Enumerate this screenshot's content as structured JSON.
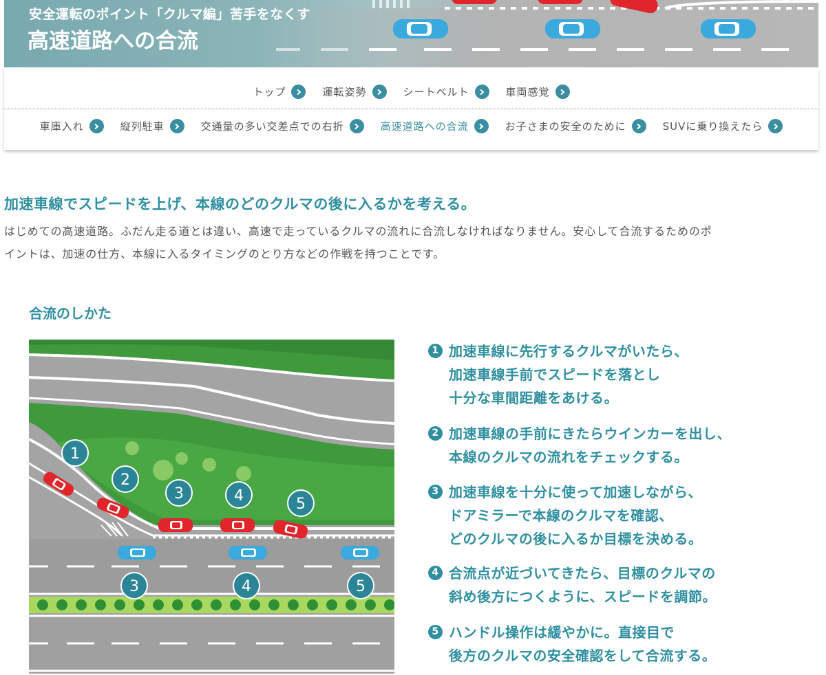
{
  "hero": {
    "subtitle": "安全運転のポイント「クルマ編」苦手をなくす",
    "title": "高速道路への合流"
  },
  "nav": {
    "row1": [
      {
        "label": "トップ"
      },
      {
        "label": "運転姿勢"
      },
      {
        "label": "シートベルト"
      },
      {
        "label": "車両感覚"
      }
    ],
    "row2": [
      {
        "label": "車庫入れ"
      },
      {
        "label": "縦列駐車"
      },
      {
        "label": "交通量の多い交差点での右折"
      },
      {
        "label": "高速道路への合流",
        "active": true
      },
      {
        "label": "お子さまの安全のために"
      },
      {
        "label": "SUVに乗り換えたら"
      }
    ]
  },
  "content": {
    "heading": "加速車線でスピードを上げ、本線のどのクルマの後に入るかを考える。",
    "intro_line1": "はじめての高速道路。ふだん走る道とは違い、高速で走っているクルマの流れに合流しなければなりません。安心して合流するためのポ",
    "intro_line2": "イントは、加速の仕方、本線に入るタイミングのとり方などの作戦を持つことです。",
    "section_title": "合流のしかた"
  },
  "diagram_labels": {
    "merge": [
      "1",
      "2",
      "3",
      "4",
      "5"
    ],
    "main": [
      "3",
      "4",
      "5"
    ]
  },
  "steps": [
    {
      "num": "1",
      "lines": [
        "加速車線に先行するクルマがいたら、",
        "加速車線手前でスピードを落とし",
        "十分な車間距離をあける。"
      ]
    },
    {
      "num": "2",
      "lines": [
        "加速車線の手前にきたらウインカーを出し、",
        "本線のクルマの流れをチェックする。"
      ]
    },
    {
      "num": "3",
      "lines": [
        "加速車線を十分に使って加速しながら、",
        "ドアミラーで本線のクルマを確認、",
        "どのクルマの後に入るか目標を決める。"
      ]
    },
    {
      "num": "4",
      "lines": [
        "合流点が近づいてきたら、目標のクルマの",
        "斜め後方につくように、スピードを調節。"
      ]
    },
    {
      "num": "5",
      "lines": [
        "ハンドル操作は緩やかに。直接目で",
        "後方のクルマの安全確認をして合流する。"
      ]
    }
  ],
  "colors": {
    "accent": "#2f8fa0",
    "chevron": "#3a8ea0",
    "car_red": "#e0262b",
    "car_blue": "#3aa9de",
    "grass": "#3f9a3c",
    "road": "#a4a4a4"
  },
  "icons": [
    "chevron-right-icon",
    "number-circle-icon",
    "red-car-icon",
    "blue-car-icon"
  ]
}
